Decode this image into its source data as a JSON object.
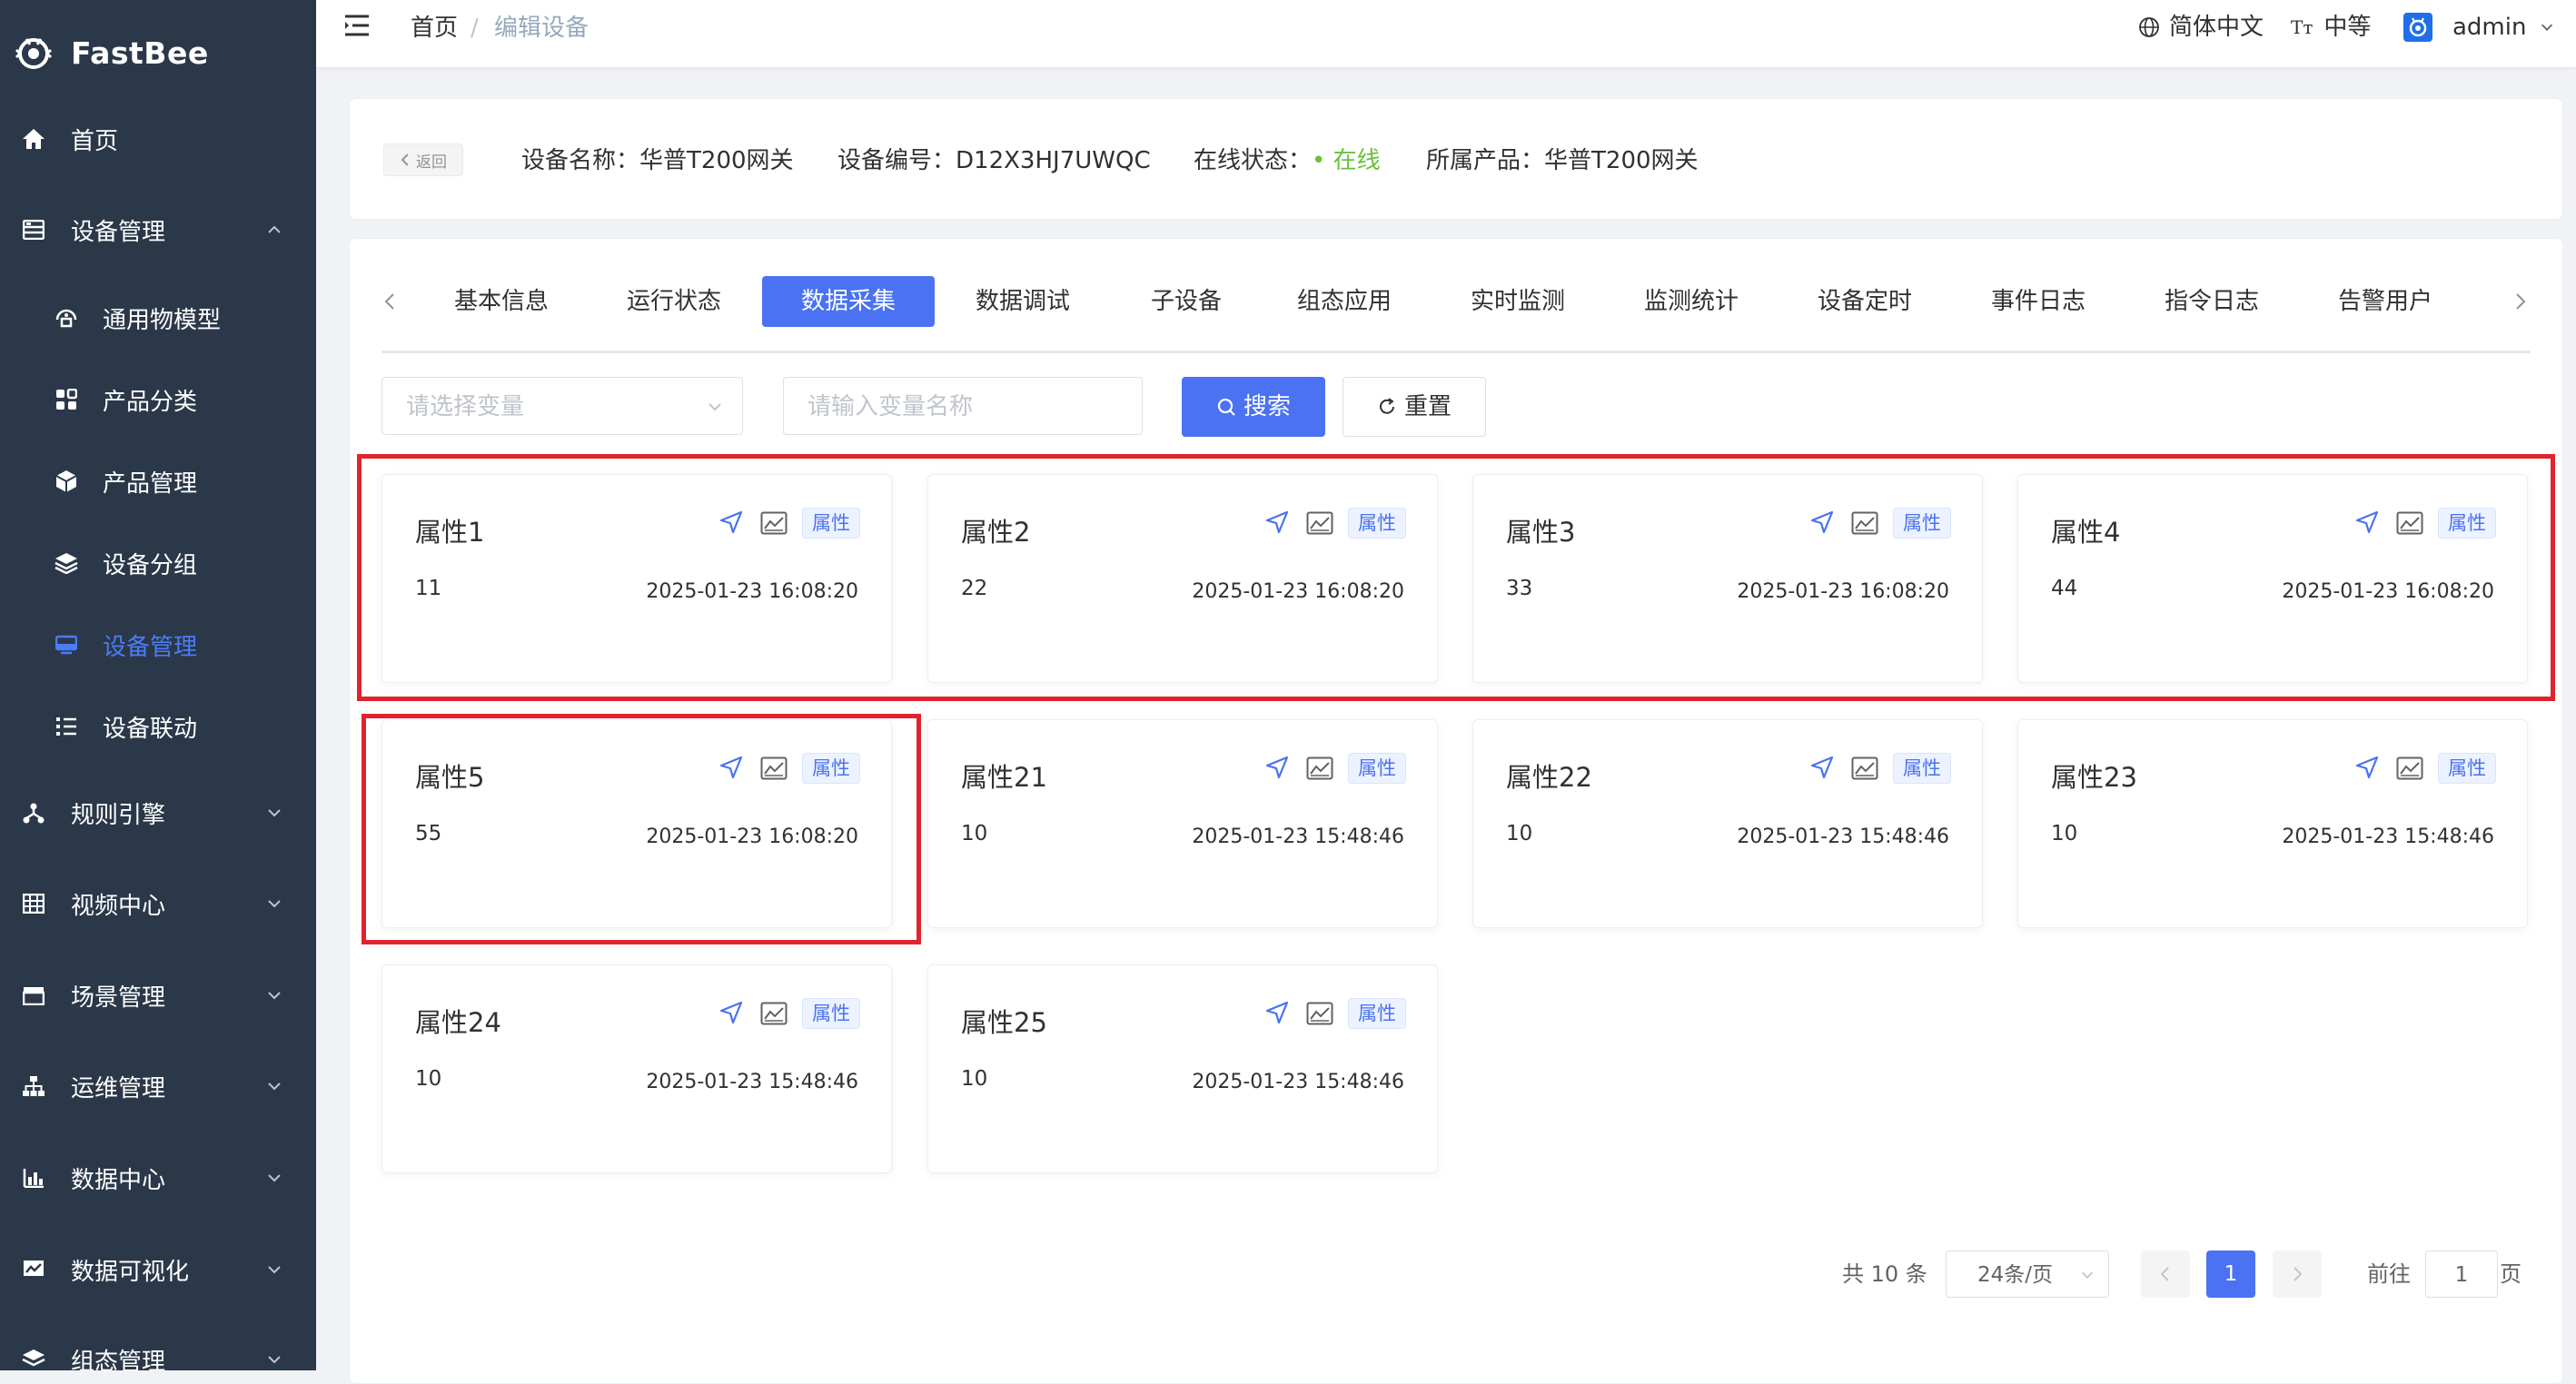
{
  "app": {
    "name": "FastBee"
  },
  "sidebar": {
    "items": [
      {
        "label": "首页",
        "icon": "home-icon",
        "level": 1
      },
      {
        "label": "设备管理",
        "icon": "device-manage-icon",
        "level": 1,
        "expanded": true
      },
      {
        "label": "通用物模型",
        "icon": "thing-model-icon",
        "level": 2
      },
      {
        "label": "产品分类",
        "icon": "category-icon",
        "level": 2
      },
      {
        "label": "产品管理",
        "icon": "product-cube-icon",
        "level": 2
      },
      {
        "label": "设备分组",
        "icon": "layers-icon",
        "level": 2
      },
      {
        "label": "设备管理",
        "icon": "monitor-icon",
        "level": 2,
        "active": true
      },
      {
        "label": "设备联动",
        "icon": "list-icon",
        "level": 2
      },
      {
        "label": "规则引擎",
        "icon": "rule-icon",
        "level": 1
      },
      {
        "label": "视频中心",
        "icon": "grid-icon",
        "level": 1
      },
      {
        "label": "场景管理",
        "icon": "clapper-icon",
        "level": 1
      },
      {
        "label": "运维管理",
        "icon": "tree-icon",
        "level": 1
      },
      {
        "label": "数据中心",
        "icon": "bar-chart-icon",
        "level": 1
      },
      {
        "label": "数据可视化",
        "icon": "screen-chart-icon",
        "level": 1
      },
      {
        "label": "组态管理",
        "icon": "layers-icon",
        "level": 1
      }
    ]
  },
  "header": {
    "breadcrumb": [
      "首页",
      "编辑设备"
    ],
    "breadcrumb_separator": "/",
    "language": "简体中文",
    "size": "中等",
    "user": "admin"
  },
  "device": {
    "back_label": "返回",
    "name_label": "设备名称：",
    "name": "华普T200网关",
    "serial_label": "设备编号：",
    "serial": "D12X3HJ7UWQC",
    "status_label": "在线状态：",
    "status": "在线",
    "status_color": "#67c23a",
    "product_label": "所属产品：",
    "product": "华普T200网关"
  },
  "tabs": {
    "items": [
      "基本信息",
      "运行状态",
      "数据采集",
      "数据调试",
      "子设备",
      "组态应用",
      "实时监测",
      "监测统计",
      "设备定时",
      "事件日志",
      "指令日志",
      "告警用户"
    ],
    "active_index": 2
  },
  "filters": {
    "variable_select_placeholder": "请选择变量",
    "variable_name_placeholder": "请输入变量名称",
    "search_label": "搜索",
    "reset_label": "重置"
  },
  "properties": [
    {
      "name": "属性1",
      "value": "11",
      "time": "2025-01-23 16:08:20",
      "tag": "属性"
    },
    {
      "name": "属性2",
      "value": "22",
      "time": "2025-01-23 16:08:20",
      "tag": "属性"
    },
    {
      "name": "属性3",
      "value": "33",
      "time": "2025-01-23 16:08:20",
      "tag": "属性"
    },
    {
      "name": "属性4",
      "value": "44",
      "time": "2025-01-23 16:08:20",
      "tag": "属性"
    },
    {
      "name": "属性5",
      "value": "55",
      "time": "2025-01-23 16:08:20",
      "tag": "属性"
    },
    {
      "name": "属性21",
      "value": "10",
      "time": "2025-01-23 15:48:46",
      "tag": "属性"
    },
    {
      "name": "属性22",
      "value": "10",
      "time": "2025-01-23 15:48:46",
      "tag": "属性"
    },
    {
      "name": "属性23",
      "value": "10",
      "time": "2025-01-23 15:48:46",
      "tag": "属性"
    },
    {
      "name": "属性24",
      "value": "10",
      "time": "2025-01-23 15:48:46",
      "tag": "属性"
    },
    {
      "name": "属性25",
      "value": "10",
      "time": "2025-01-23 15:48:46",
      "tag": "属性"
    }
  ],
  "pagination": {
    "total_text": "共 10 条",
    "page_size": "24条/页",
    "current_page": "1",
    "goto_label": "前往",
    "goto_value": "1",
    "page_suffix": "页"
  },
  "colors": {
    "primary": "#4a72f2",
    "sidebar_bg": "#2b3849",
    "highlight_box": "#e0242e",
    "online": "#67c23a"
  }
}
